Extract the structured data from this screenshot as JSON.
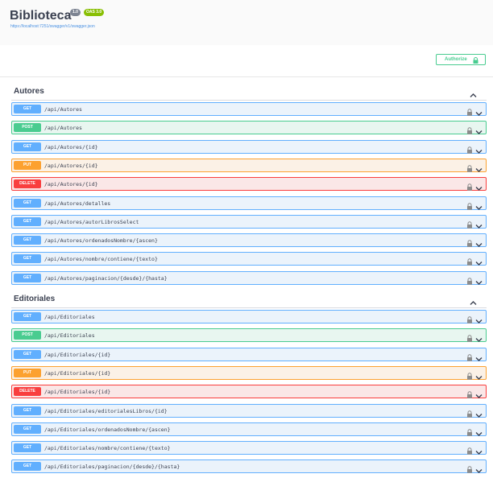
{
  "info": {
    "title": "Biblioteca",
    "version": "1.0",
    "oas": "OAS 3.0",
    "url": "https://localhost:7251/swagger/v1/swagger.json"
  },
  "authorize": {
    "label": "Authorize",
    "icon": "lock-icon"
  },
  "colors": {
    "get": "#61affe",
    "post": "#49cc90",
    "put": "#fca130",
    "delete": "#f93e3e"
  },
  "sections": [
    {
      "name": "Autores",
      "operations": [
        {
          "method": "GET",
          "path": "/api/Autores"
        },
        {
          "method": "POST",
          "path": "/api/Autores"
        },
        {
          "method": "GET",
          "path": "/api/Autores/{id}"
        },
        {
          "method": "PUT",
          "path": "/api/Autores/{id}"
        },
        {
          "method": "DELETE",
          "path": "/api/Autores/{id}"
        },
        {
          "method": "GET",
          "path": "/api/Autores/detalles"
        },
        {
          "method": "GET",
          "path": "/api/Autores/autorLibrosSelect"
        },
        {
          "method": "GET",
          "path": "/api/Autores/ordenadosNombre/{ascen}"
        },
        {
          "method": "GET",
          "path": "/api/Autores/nombre/contiene/{texto}"
        },
        {
          "method": "GET",
          "path": "/api/Autores/paginacion/{desde}/{hasta}"
        }
      ]
    },
    {
      "name": "Editoriales",
      "operations": [
        {
          "method": "GET",
          "path": "/api/Editoriales"
        },
        {
          "method": "POST",
          "path": "/api/Editoriales"
        },
        {
          "method": "GET",
          "path": "/api/Editoriales/{id}"
        },
        {
          "method": "PUT",
          "path": "/api/Editoriales/{id}"
        },
        {
          "method": "DELETE",
          "path": "/api/Editoriales/{id}"
        },
        {
          "method": "GET",
          "path": "/api/Editoriales/editorialesLibros/{id}"
        },
        {
          "method": "GET",
          "path": "/api/Editoriales/ordenadosNombre/{ascen}"
        },
        {
          "method": "GET",
          "path": "/api/Editoriales/nombre/contiene/{texto}"
        },
        {
          "method": "GET",
          "path": "/api/Editoriales/paginacion/{desde}/{hasta}"
        }
      ]
    }
  ]
}
